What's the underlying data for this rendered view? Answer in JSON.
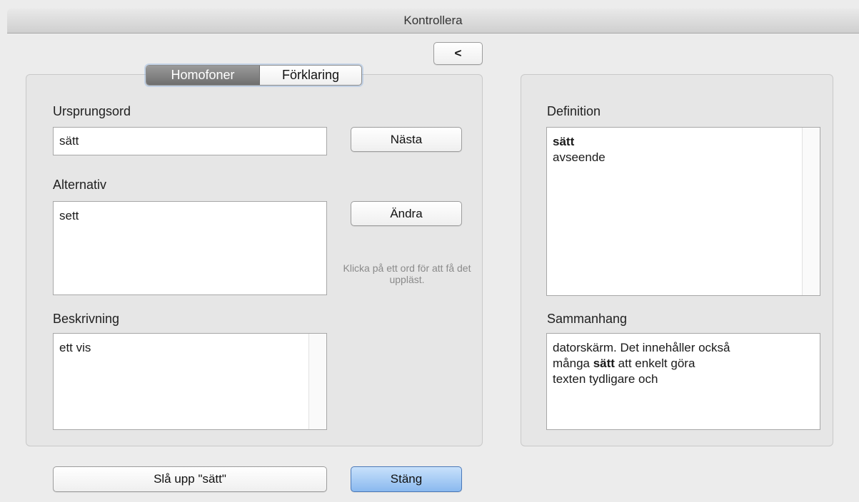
{
  "window": {
    "title": "Kontrollera"
  },
  "toolbar": {
    "back_label": "<"
  },
  "tabs": [
    {
      "label": "Homofoner",
      "active": true
    },
    {
      "label": "Förklaring",
      "active": false
    }
  ],
  "left": {
    "origin_label": "Ursprungsord",
    "origin_value": "sätt",
    "next_button": "Nästa",
    "alternatives_label": "Alternativ",
    "alternatives": [
      "sett"
    ],
    "change_button": "Ändra",
    "hint": "Klicka på ett ord för att få det uppläst.",
    "description_label": "Beskrivning",
    "description": "ett vis"
  },
  "right": {
    "definition_label": "Definition",
    "definition_word": "sätt",
    "definition_text": "avseende",
    "context_label": "Sammanhang",
    "context_line1": "datorskärm. Det innehåller också",
    "context_line2_pre": "många ",
    "context_line2_bold": "sätt",
    "context_line2_post": " att enkelt göra",
    "context_line3": "texten tydligare och"
  },
  "footer": {
    "lookup_button": "Slå upp \"sätt\"",
    "close_button": "Stäng"
  },
  "colors": {
    "default_button": "#8ab9ef",
    "active_tab": "#7f7f7f",
    "window_bg": "#ececec"
  }
}
